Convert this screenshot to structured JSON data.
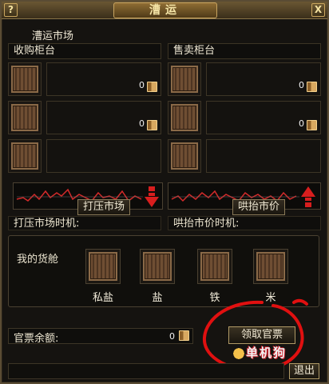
{
  "window": {
    "title": "漕运",
    "help_label": "?",
    "close_label": "X"
  },
  "market": {
    "title": "漕运市场",
    "buy_counter": {
      "header": "收购柜台",
      "slots": [
        {
          "count": "0"
        },
        {
          "count": "0"
        },
        {
          "count": ""
        }
      ]
    },
    "sell_counter": {
      "header": "售卖柜台",
      "slots": [
        {
          "count": "0"
        },
        {
          "count": "0"
        },
        {
          "count": ""
        }
      ]
    },
    "suppress_button": "打压市场",
    "boost_button": "哄抬市价",
    "suppress_timing": "打压市场时机:",
    "boost_timing": "哄抬市价时机:",
    "suppress_arrow_color": "#d81e1e",
    "boost_arrow_color": "#d81e1e"
  },
  "hold": {
    "title": "我的货舱",
    "items": [
      {
        "name": "私盐",
        "icon": "crate-icon"
      },
      {
        "name": "盐",
        "icon": "crate-icon"
      },
      {
        "name": "铁",
        "icon": "crate-icon"
      },
      {
        "name": "米",
        "icon": "crate-icon"
      }
    ]
  },
  "balance": {
    "label": "官票余额:",
    "count": "0"
  },
  "actions": {
    "claim_label": "领取官票",
    "exit_label": "退出"
  },
  "watermark": {
    "text": "单机狗"
  },
  "colors": {
    "annotation_red": "#e01010",
    "frame_gold": "#c8a460"
  }
}
